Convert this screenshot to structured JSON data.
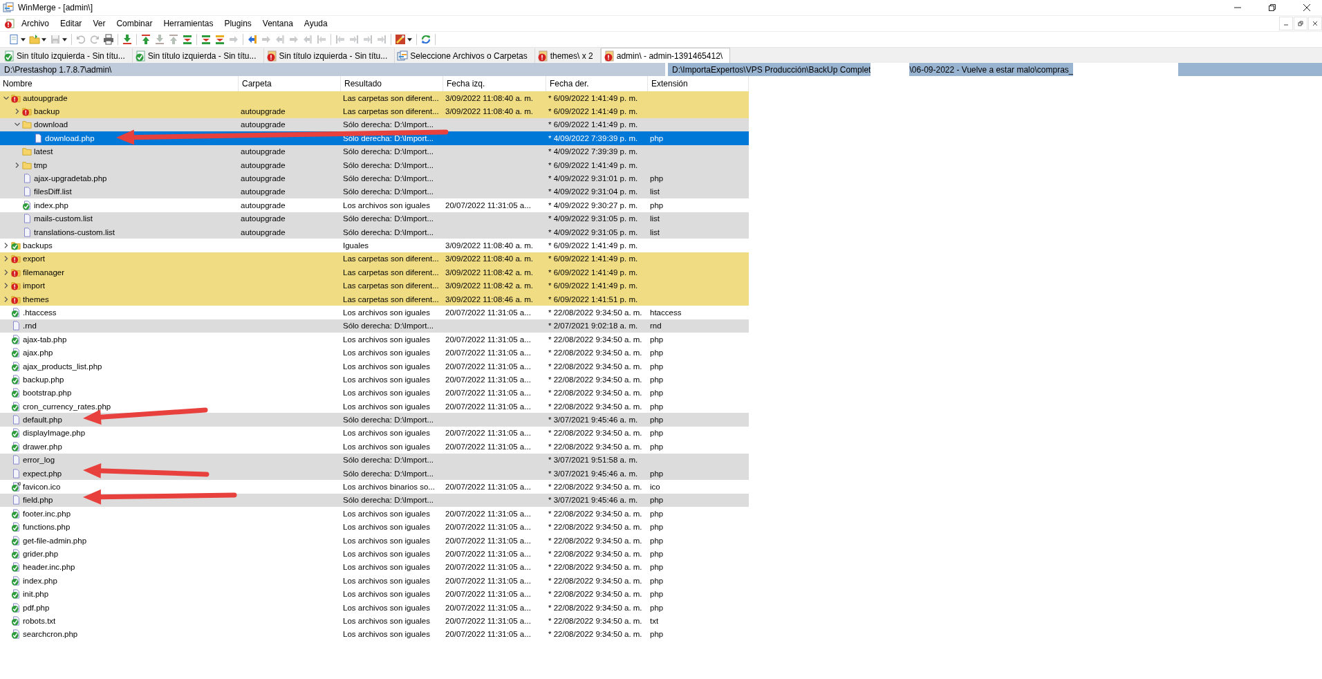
{
  "window": {
    "title": "WinMerge - [admin\\]"
  },
  "menu": [
    "Archivo",
    "Editar",
    "Ver",
    "Combinar",
    "Herramientas",
    "Plugins",
    "Ventana",
    "Ayuda"
  ],
  "toolbar": [
    {
      "disabled": false
    },
    {
      "disabled": false
    },
    {
      "disabled": true
    },
    {
      "disabled": true
    },
    {
      "disabled": true
    },
    {
      "disabled": false
    },
    {
      "disabled": false
    },
    {
      "disabled": false
    },
    {
      "disabled": true
    },
    {
      "disabled": true
    },
    {
      "disabled": false
    },
    {
      "disabled": false
    },
    {
      "disabled": false
    },
    {
      "disabled": true
    },
    {
      "disabled": false
    },
    {
      "disabled": true
    },
    {
      "disabled": true
    },
    {
      "disabled": true
    },
    {
      "disabled": true
    },
    {
      "disabled": true
    },
    {
      "disabled": true
    },
    {
      "disabled": true
    },
    {
      "disabled": true
    },
    {
      "disabled": true
    },
    {
      "disabled": false
    },
    {
      "disabled": false
    }
  ],
  "tabs": [
    {
      "label": "Sin título izquierda - Sin títu...",
      "kind": "equal",
      "selected": false
    },
    {
      "label": "Sin título izquierda - Sin títu...",
      "kind": "equal",
      "selected": false
    },
    {
      "label": "Sin título izquierda - Sin títu...",
      "kind": "different",
      "selected": false
    },
    {
      "label": "Seleccione Archivos o Carpetas",
      "kind": "open",
      "selected": false
    },
    {
      "label": "themes\\ x 2",
      "kind": "different",
      "selected": false
    },
    {
      "label": "admin\\ - admin-1391465412\\",
      "kind": "different",
      "selected": true
    }
  ],
  "left_path": "D:\\Prestashop 1.7.8.7\\admin\\",
  "right_path": [
    "D:\\ImportaExpertos\\VPS Producción\\BackUp Complet",
    "\\06-09-2022 -  Vuelve a estar malo\\compras_"
  ],
  "columns": [
    "Nombre",
    "Carpeta",
    "Resultado",
    "Fecha izq.",
    "Fecha der.",
    "Extensión"
  ],
  "rows": [
    {
      "name": "autoupgrade",
      "kind": "different-folder",
      "selected": false,
      "expanded": true,
      "result": "Las carpetas son diferent...",
      "left": "3/09/2022 11:08:40 a. m.",
      "right": "* 6/09/2022 1:41:49 p. m.",
      "children": [
        {
          "name": "backup",
          "kind": "different-folder",
          "selected": false,
          "expanded": false,
          "folder": "autoupgrade",
          "result": "Las carpetas son diferent...",
          "left": "3/09/2022 11:08:40 a. m.",
          "right": "* 6/09/2022 1:41:49 p. m."
        },
        {
          "name": "download",
          "kind": "right-only-folder",
          "selected": false,
          "expanded": true,
          "folder": "autoupgrade",
          "result": "Sólo derecha: D:\\Import...",
          "right": "* 6/09/2022 1:41:49 p. m.",
          "children": [
            {
              "name": "download.php",
              "kind": "right-only-file",
              "selected": true,
              "result": "Sólo derecha: D:\\Import...",
              "right": "* 4/09/2022 7:39:39 p. m.",
              "ext": "php"
            }
          ]
        },
        {
          "name": "latest",
          "kind": "right-only-folder",
          "selected": false,
          "folder": "autoupgrade",
          "result": "Sólo derecha: D:\\Import...",
          "right": "* 4/09/2022 7:39:39 p. m."
        },
        {
          "name": "tmp",
          "kind": "right-only-folder",
          "selected": false,
          "expanded": false,
          "folder": "autoupgrade",
          "result": "Sólo derecha: D:\\Import...",
          "right": "* 6/09/2022 1:41:49 p. m."
        },
        {
          "name": "ajax-upgradetab.php",
          "kind": "right-only-file",
          "selected": false,
          "folder": "autoupgrade",
          "result": "Sólo derecha: D:\\Import...",
          "right": "* 4/09/2022 9:31:01 p. m.",
          "ext": "php"
        },
        {
          "name": "filesDiff.list",
          "kind": "right-only-file",
          "selected": false,
          "folder": "autoupgrade",
          "result": "Sólo derecha: D:\\Import...",
          "right": "* 4/09/2022 9:31:04 p. m.",
          "ext": "list"
        },
        {
          "name": "index.php",
          "kind": "equal-file",
          "selected": false,
          "folder": "autoupgrade",
          "result": "Los archivos son iguales",
          "left": "20/07/2022 11:31:05 a...",
          "right": "* 4/09/2022 9:30:27 p. m.",
          "ext": "php"
        },
        {
          "name": "mails-custom.list",
          "kind": "right-only-file",
          "selected": false,
          "folder": "autoupgrade",
          "result": "Sólo derecha: D:\\Import...",
          "right": "* 4/09/2022 9:31:05 p. m.",
          "ext": "list"
        },
        {
          "name": "translations-custom.list",
          "kind": "right-only-file",
          "selected": false,
          "folder": "autoupgrade",
          "result": "Sólo derecha: D:\\Import...",
          "right": "* 4/09/2022 9:31:05 p. m.",
          "ext": "list"
        }
      ]
    },
    {
      "name": "backups",
      "kind": "equal-folder",
      "selected": false,
      "expanded": false,
      "result": "Iguales",
      "left": "3/09/2022 11:08:40 a. m.",
      "right": "* 6/09/2022 1:41:49 p. m."
    },
    {
      "name": "export",
      "kind": "different-folder",
      "selected": false,
      "expanded": false,
      "result": "Las carpetas son diferent...",
      "left": "3/09/2022 11:08:40 a. m.",
      "right": "* 6/09/2022 1:41:49 p. m."
    },
    {
      "name": "filemanager",
      "kind": "different-folder",
      "selected": false,
      "expanded": false,
      "result": "Las carpetas son diferent...",
      "left": "3/09/2022 11:08:42 a. m.",
      "right": "* 6/09/2022 1:41:49 p. m."
    },
    {
      "name": "import",
      "kind": "different-folder",
      "selected": false,
      "expanded": false,
      "result": "Las carpetas son diferent...",
      "left": "3/09/2022 11:08:42 a. m.",
      "right": "* 6/09/2022 1:41:49 p. m."
    },
    {
      "name": "themes",
      "kind": "different-folder",
      "selected": false,
      "expanded": false,
      "result": "Las carpetas son diferent...",
      "left": "3/09/2022 11:08:46 a. m.",
      "right": "* 6/09/2022 1:41:51 p. m."
    },
    {
      "name": ".htaccess",
      "kind": "equal-file",
      "selected": false,
      "result": "Los archivos son iguales",
      "left": "20/07/2022 11:31:05 a...",
      "right": "* 22/08/2022 9:34:50 a. m.",
      "ext": "htaccess"
    },
    {
      "name": ".rnd",
      "kind": "right-only-file",
      "selected": false,
      "result": "Sólo derecha: D:\\Import...",
      "right": "* 2/07/2021 9:02:18 a. m.",
      "ext": "rnd"
    },
    {
      "name": "ajax-tab.php",
      "kind": "equal-file",
      "selected": false,
      "result": "Los archivos son iguales",
      "left": "20/07/2022 11:31:05 a...",
      "right": "* 22/08/2022 9:34:50 a. m.",
      "ext": "php"
    },
    {
      "name": "ajax.php",
      "kind": "equal-file",
      "selected": false,
      "result": "Los archivos son iguales",
      "left": "20/07/2022 11:31:05 a...",
      "right": "* 22/08/2022 9:34:50 a. m.",
      "ext": "php"
    },
    {
      "name": "ajax_products_list.php",
      "kind": "equal-file",
      "selected": false,
      "result": "Los archivos son iguales",
      "left": "20/07/2022 11:31:05 a...",
      "right": "* 22/08/2022 9:34:50 a. m.",
      "ext": "php"
    },
    {
      "name": "backup.php",
      "kind": "equal-file",
      "selected": false,
      "result": "Los archivos son iguales",
      "left": "20/07/2022 11:31:05 a...",
      "right": "* 22/08/2022 9:34:50 a. m.",
      "ext": "php"
    },
    {
      "name": "bootstrap.php",
      "kind": "equal-file",
      "selected": false,
      "result": "Los archivos son iguales",
      "left": "20/07/2022 11:31:05 a...",
      "right": "* 22/08/2022 9:34:50 a. m.",
      "ext": "php"
    },
    {
      "name": "cron_currency_rates.php",
      "kind": "equal-file",
      "selected": false,
      "result": "Los archivos son iguales",
      "left": "20/07/2022 11:31:05 a...",
      "right": "* 22/08/2022 9:34:50 a. m.",
      "ext": "php"
    },
    {
      "name": "default.php",
      "kind": "right-only-file",
      "selected": false,
      "result": "Sólo derecha: D:\\Import...",
      "right": "* 3/07/2021 9:45:46 a. m.",
      "ext": "php"
    },
    {
      "name": "displayImage.php",
      "kind": "equal-file",
      "selected": false,
      "result": "Los archivos son iguales",
      "left": "20/07/2022 11:31:05 a...",
      "right": "* 22/08/2022 9:34:50 a. m.",
      "ext": "php"
    },
    {
      "name": "drawer.php",
      "kind": "equal-file",
      "selected": false,
      "result": "Los archivos son iguales",
      "left": "20/07/2022 11:31:05 a...",
      "right": "* 22/08/2022 9:34:50 a. m.",
      "ext": "php"
    },
    {
      "name": "error_log",
      "kind": "right-only-file",
      "selected": false,
      "result": "Sólo derecha: D:\\Import...",
      "right": "* 3/07/2021 9:51:58 a. m."
    },
    {
      "name": "expect.php",
      "kind": "right-only-file",
      "selected": false,
      "result": "Sólo derecha: D:\\Import...",
      "right": "* 3/07/2021 9:45:46 a. m.",
      "ext": "php"
    },
    {
      "name": "favicon.ico",
      "kind": "binary-equal-file",
      "selected": false,
      "result": "Los archivos binarios so...",
      "left": "20/07/2022 11:31:05 a...",
      "right": "* 22/08/2022 9:34:50 a. m.",
      "ext": "ico"
    },
    {
      "name": "field.php",
      "kind": "right-only-file",
      "selected": false,
      "result": "Sólo derecha: D:\\Import...",
      "right": "* 3/07/2021 9:45:46 a. m.",
      "ext": "php"
    },
    {
      "name": "footer.inc.php",
      "kind": "equal-file",
      "selected": false,
      "result": "Los archivos son iguales",
      "left": "20/07/2022 11:31:05 a...",
      "right": "* 22/08/2022 9:34:50 a. m.",
      "ext": "php"
    },
    {
      "name": "functions.php",
      "kind": "equal-file",
      "selected": false,
      "result": "Los archivos son iguales",
      "left": "20/07/2022 11:31:05 a...",
      "right": "* 22/08/2022 9:34:50 a. m.",
      "ext": "php"
    },
    {
      "name": "get-file-admin.php",
      "kind": "equal-file",
      "selected": false,
      "result": "Los archivos son iguales",
      "left": "20/07/2022 11:31:05 a...",
      "right": "* 22/08/2022 9:34:50 a. m.",
      "ext": "php"
    },
    {
      "name": "grider.php",
      "kind": "equal-file",
      "selected": false,
      "result": "Los archivos son iguales",
      "left": "20/07/2022 11:31:05 a...",
      "right": "* 22/08/2022 9:34:50 a. m.",
      "ext": "php"
    },
    {
      "name": "header.inc.php",
      "kind": "equal-file",
      "selected": false,
      "result": "Los archivos son iguales",
      "left": "20/07/2022 11:31:05 a...",
      "right": "* 22/08/2022 9:34:50 a. m.",
      "ext": "php"
    },
    {
      "name": "index.php",
      "kind": "equal-file",
      "selected": false,
      "result": "Los archivos son iguales",
      "left": "20/07/2022 11:31:05 a...",
      "right": "* 22/08/2022 9:34:50 a. m.",
      "ext": "php"
    },
    {
      "name": "init.php",
      "kind": "equal-file",
      "selected": false,
      "result": "Los archivos son iguales",
      "left": "20/07/2022 11:31:05 a...",
      "right": "* 22/08/2022 9:34:50 a. m.",
      "ext": "php"
    },
    {
      "name": "pdf.php",
      "kind": "equal-file",
      "selected": false,
      "result": "Los archivos son iguales",
      "left": "20/07/2022 11:31:05 a...",
      "right": "* 22/08/2022 9:34:50 a. m.",
      "ext": "php"
    },
    {
      "name": "robots.txt",
      "kind": "equal-file",
      "selected": false,
      "result": "Los archivos son iguales",
      "left": "20/07/2022 11:31:05 a...",
      "right": "* 22/08/2022 9:34:50 a. m.",
      "ext": "txt"
    },
    {
      "name": "searchcron.php",
      "kind": "equal-file",
      "selected": false,
      "result": "Los archivos son iguales",
      "left": "20/07/2022 11:31:05 a...",
      "right": "* 22/08/2022 9:34:50 a. m.",
      "ext": "php"
    }
  ]
}
